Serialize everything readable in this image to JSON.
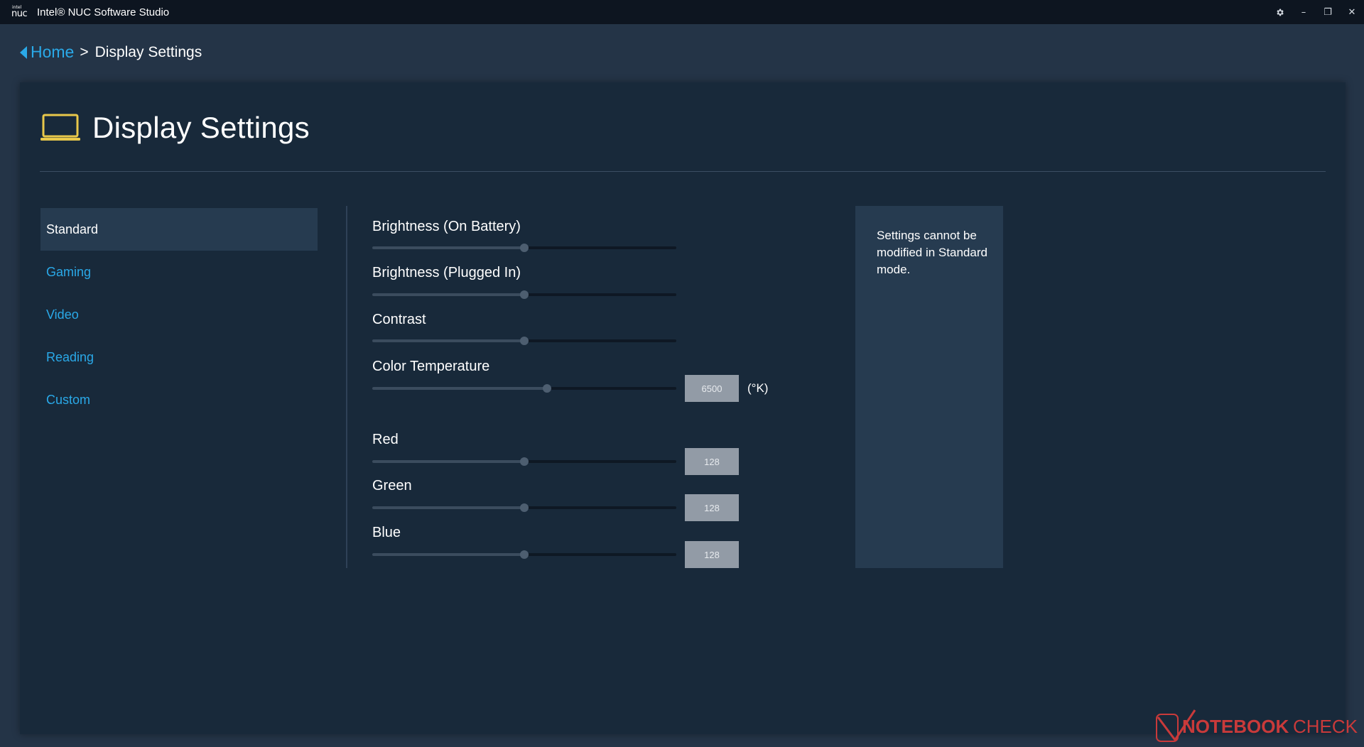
{
  "app": {
    "logo_top": "intel",
    "logo_bottom": "nuc",
    "title": "Intel® NUC Software Studio"
  },
  "window_controls": {
    "settings_icon": "gear-icon",
    "minimize": "–",
    "restore": "❐",
    "close": "✕"
  },
  "breadcrumb": {
    "home": "Home",
    "separator": ">",
    "current": "Display Settings"
  },
  "page": {
    "title": "Display Settings",
    "icon": "laptop-icon",
    "icon_color": "#e8c84a"
  },
  "sidebar": {
    "items": [
      {
        "label": "Standard",
        "active": true
      },
      {
        "label": "Gaming",
        "active": false
      },
      {
        "label": "Video",
        "active": false
      },
      {
        "label": "Reading",
        "active": false
      },
      {
        "label": "Custom",
        "active": false
      }
    ]
  },
  "controls": {
    "brightness_battery": {
      "label": "Brightness (On Battery)",
      "value": 0.5
    },
    "brightness_plugged": {
      "label": "Brightness (Plugged In)",
      "value": 0.5
    },
    "contrast": {
      "label": "Contrast",
      "value": 0.5
    },
    "color_temperature": {
      "label": "Color Temperature",
      "value": 0.575,
      "display": "6500",
      "unit": "(°K)"
    },
    "red": {
      "label": "Red",
      "value": 0.5,
      "display": "128"
    },
    "green": {
      "label": "Green",
      "value": 0.5,
      "display": "128"
    },
    "blue": {
      "label": "Blue",
      "value": 0.5,
      "display": "128"
    }
  },
  "info": {
    "text": "Settings cannot be modified in Standard mode."
  },
  "watermark": {
    "text_bold": "NOTEBOOK",
    "text_light": "CHECK"
  },
  "colors": {
    "accent": "#2aa9e8",
    "background": "#243447",
    "panel": "#18293a"
  }
}
